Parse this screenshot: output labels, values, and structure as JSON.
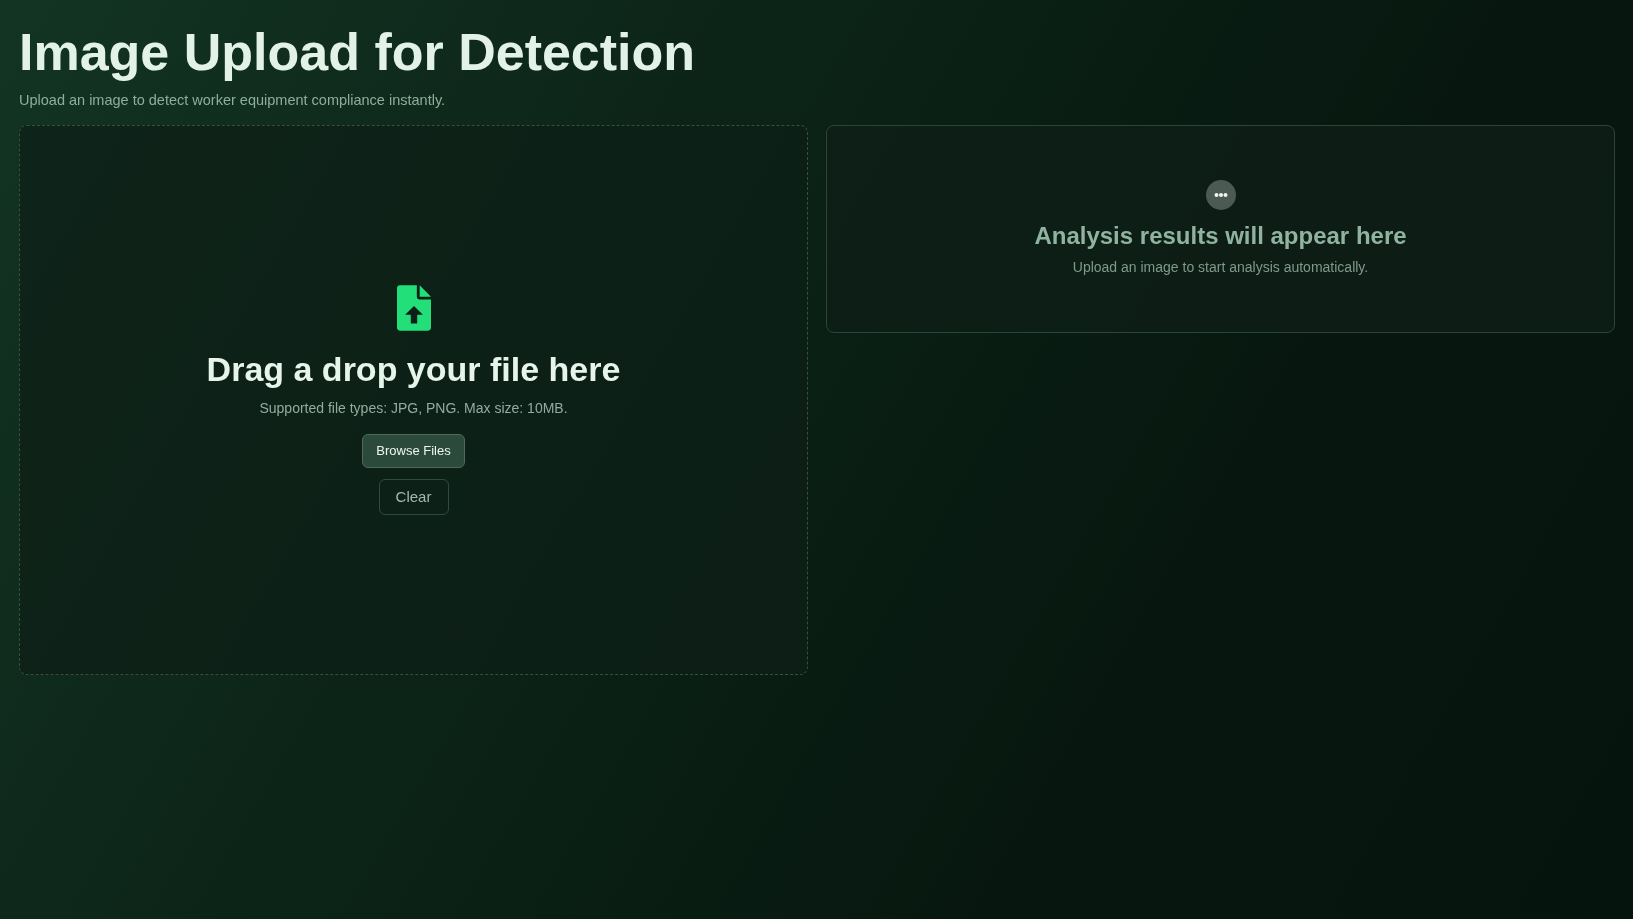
{
  "page": {
    "title": "Image Upload for Detection",
    "subtitle": "Upload an image to detect worker equipment compliance instantly."
  },
  "upload_panel": {
    "heading": "Drag a drop your file here",
    "hint": "Supported file types: JPG, PNG. Max size: 10MB.",
    "buttons": [
      {
        "label": "Browse Files",
        "kind": "primary"
      },
      {
        "label": "Clear",
        "kind": "outline"
      }
    ]
  },
  "results_panel": {
    "heading": "Analysis results will appear here",
    "message": "Upload an image to start analysis automatically."
  }
}
